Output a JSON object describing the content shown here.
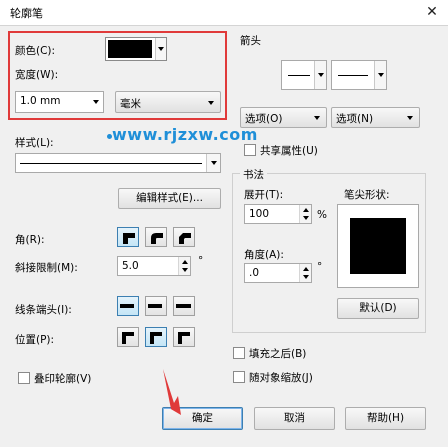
{
  "window": {
    "title": "轮廓笔",
    "close_glyph": "✕"
  },
  "color": {
    "label": "颜色(C):",
    "swatch": "#000000"
  },
  "width": {
    "label": "宽度(W):",
    "value": "1.0 mm",
    "unit": "毫米"
  },
  "arrows": {
    "label": "箭头",
    "option_left": "选项(O)",
    "option_right": "选项(N)",
    "share_label": "共享属性(U)"
  },
  "style": {
    "label": "样式(L):",
    "edit_button": "编辑样式(E)..."
  },
  "corner": {
    "label": "角(R):"
  },
  "miter": {
    "label": "斜接限制(M):",
    "value": "5.0",
    "unit": "°"
  },
  "linecaps": {
    "label": "线条端头(I):"
  },
  "position": {
    "label": "位置(P):"
  },
  "calligraphy": {
    "label": "书法",
    "stretch_label": "展开(T):",
    "stretch_value": "100",
    "stretch_unit": "%",
    "angle_label": "角度(A):",
    "angle_value": ".0",
    "angle_unit": "°",
    "nib_label": "笔尖形状:",
    "default_button": "默认(D)"
  },
  "options": {
    "behind_fill": "填充之后(B)",
    "scale_with_object": "随对象缩放(J)",
    "overprint": "叠印轮廓(V)"
  },
  "buttons": {
    "ok": "确定",
    "cancel": "取消",
    "help": "帮助(H)"
  },
  "watermark": {
    "text": "www.rjzxw.com"
  },
  "colors": {
    "highlight": "#e03a3a",
    "accent": "#3c7fb1",
    "watermark": "#1f8fd8",
    "arrow_pointer": "#e03a3a"
  }
}
